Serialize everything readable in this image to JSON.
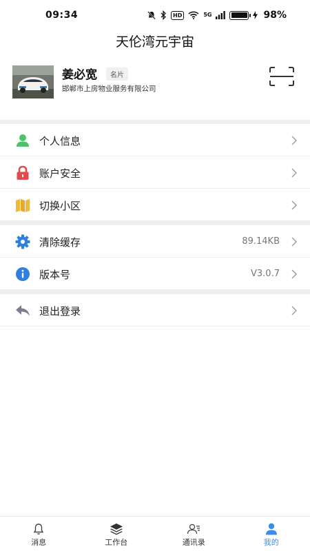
{
  "status": {
    "time": "09:34",
    "hd": "HD",
    "network": "5G",
    "battery": "98%",
    "battery_level": 0.98
  },
  "header": {
    "title": "天伦湾元宇宙"
  },
  "profile": {
    "name": "姜必宽",
    "badge": "名片",
    "company": "邯郸市上房物业服务有限公司"
  },
  "menu": {
    "group1": [
      {
        "label": "个人信息",
        "icon": "person-icon",
        "color": "#4cc26b"
      },
      {
        "label": "账户安全",
        "icon": "lock-icon",
        "color": "#e14b4b"
      },
      {
        "label": "切换小区",
        "icon": "map-icon",
        "color": "#f0b93a"
      }
    ],
    "group2": [
      {
        "label": "清除缓存",
        "value": "89.14KB",
        "icon": "gear-icon",
        "color": "#2f7fde"
      },
      {
        "label": "版本号",
        "value": "V3.0.7",
        "icon": "info-icon",
        "color": "#2f7fde"
      }
    ],
    "group3": [
      {
        "label": "退出登录",
        "icon": "reply-icon",
        "color": "#7a7f8a"
      }
    ]
  },
  "tabbar": [
    {
      "label": "消息",
      "icon": "bell-icon"
    },
    {
      "label": "工作台",
      "icon": "layers-icon"
    },
    {
      "label": "通讯录",
      "icon": "contacts-icon"
    },
    {
      "label": "我的",
      "icon": "user-icon",
      "active": true
    }
  ],
  "colors": {
    "accent": "#3a8ee6",
    "divider": "#eeeeee"
  }
}
